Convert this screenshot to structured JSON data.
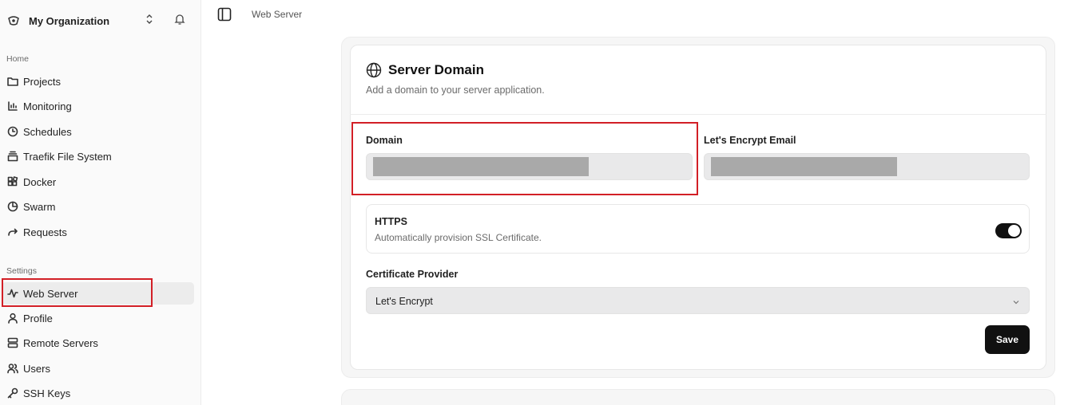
{
  "sidebar": {
    "org_name": "My Organization",
    "home_label": "Home",
    "settings_label": "Settings",
    "home_items": [
      {
        "label": "Projects",
        "icon": "folder-icon"
      },
      {
        "label": "Monitoring",
        "icon": "chart-icon"
      },
      {
        "label": "Schedules",
        "icon": "clock-icon"
      },
      {
        "label": "Traefik File System",
        "icon": "file-system-icon"
      },
      {
        "label": "Docker",
        "icon": "docker-icon"
      },
      {
        "label": "Swarm",
        "icon": "swarm-icon"
      },
      {
        "label": "Requests",
        "icon": "arrow-icon"
      }
    ],
    "settings_items": [
      {
        "label": "Web Server",
        "icon": "activity-icon",
        "active": true
      },
      {
        "label": "Profile",
        "icon": "user-icon"
      },
      {
        "label": "Remote Servers",
        "icon": "server-icon"
      },
      {
        "label": "Users",
        "icon": "users-icon"
      },
      {
        "label": "SSH Keys",
        "icon": "key-icon"
      }
    ]
  },
  "header": {
    "breadcrumb": "Web Server"
  },
  "server_domain": {
    "title": "Server Domain",
    "description": "Add a domain to your server application.",
    "domain_label": "Domain",
    "domain_value": "",
    "email_label": "Let's Encrypt Email",
    "email_value": "",
    "https_title": "HTTPS",
    "https_description": "Automatically provision SSL Certificate.",
    "https_enabled": true,
    "certificate_label": "Certificate Provider",
    "certificate_value": "Let's Encrypt",
    "save_label": "Save"
  },
  "colors": {
    "highlight": "#d21f26",
    "button": "#111111",
    "input_bg": "#e9e9ea"
  }
}
